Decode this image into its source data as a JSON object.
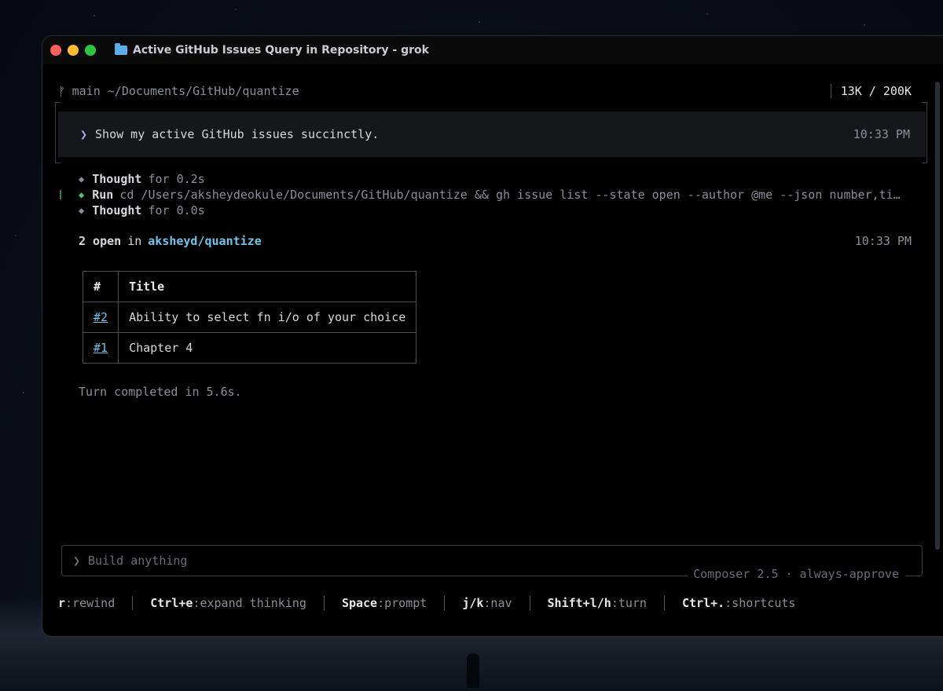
{
  "window": {
    "title": "Active GitHub Issues Query in Repository - grok",
    "colors": {
      "close": "#ff5f57",
      "minimize": "#febc2e",
      "zoom": "#28c840",
      "accent": "#6fc4e8"
    }
  },
  "status": {
    "branch_icon": "ᚠ",
    "branch_and_path": "main ~/Documents/GitHub/quantize",
    "tokens": "13K / 200K"
  },
  "prompt": {
    "chevron": "❯",
    "text": "Show my active GitHub issues succinctly.",
    "time": "10:33 PM"
  },
  "steps": [
    {
      "key": "Thought",
      "text": "for 0.2s"
    },
    {
      "key": "Run",
      "text": "cd /Users/aksheydeokule/Documents/GitHub/quantize && gh issue list --state open --author @me --json number,ti…"
    },
    {
      "key": "Thought",
      "text": "for 0.0s"
    }
  ],
  "summary": {
    "count": "2 open",
    "in": "in",
    "repo": "aksheyd/quantize",
    "time": "10:33 PM"
  },
  "table": {
    "headers": [
      "#",
      "Title"
    ],
    "rows": [
      {
        "number": "#2",
        "title": "Ability to select fn i/o of your choice"
      },
      {
        "number": "#1",
        "title": "Chapter 4"
      }
    ]
  },
  "completed": "Turn completed in 5.6s.",
  "composer": {
    "chevron": "❯",
    "placeholder": "Build anything",
    "model_label": "Composer 2.5 · always-approve"
  },
  "hints": [
    {
      "key": "r",
      "label": ":rewind"
    },
    {
      "key": "Ctrl+e",
      "label": ":expand thinking"
    },
    {
      "key": "Space",
      "label": ":prompt"
    },
    {
      "key": "j/k",
      "label": ":nav"
    },
    {
      "key": "Shift+l/h",
      "label": ":turn"
    },
    {
      "key": "Ctrl+.",
      "label": ":shortcuts"
    }
  ]
}
